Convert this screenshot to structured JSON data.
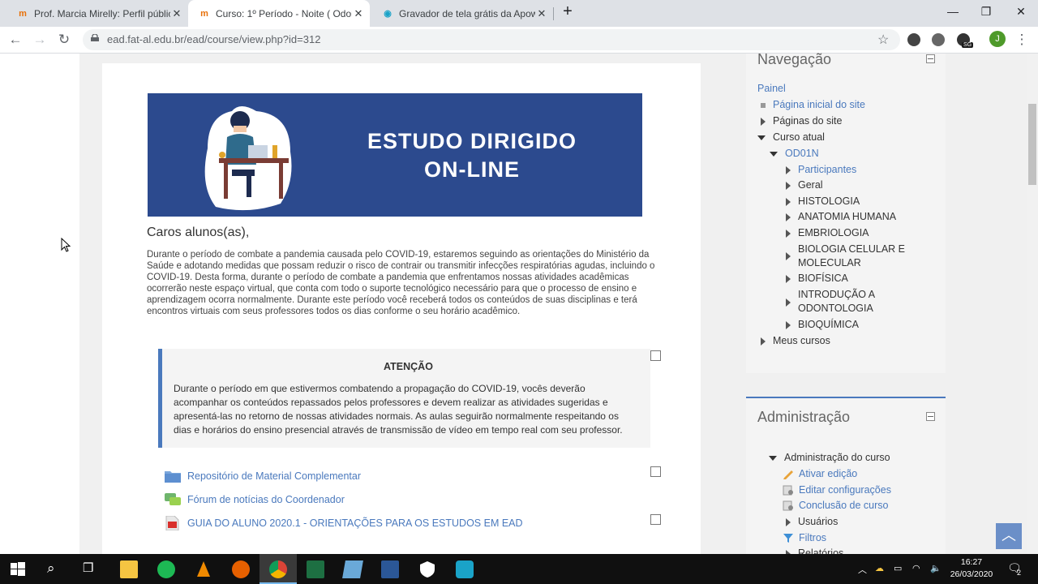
{
  "browser": {
    "tabs": [
      {
        "title": "Prof. Marcia Mirelly: Perfil público",
        "favicon": "moodle-icon",
        "active": false
      },
      {
        "title": "Curso: 1º Período - Noite ( Odon",
        "favicon": "moodle-icon",
        "active": true
      },
      {
        "title": "Gravador de tela grátis da Apowe",
        "favicon": "recorder-icon",
        "active": false
      }
    ],
    "url": "ead.fat-al.edu.br/ead/course/view.php?id=312",
    "profile_initial": "J",
    "extension_badge": "SG"
  },
  "main": {
    "banner_text_line1": "ESTUDO DIRIGIDO",
    "banner_text_line2": "ON-LINE",
    "greeting": "Caros alunos(as),",
    "intro": "Durante o período de combate a pandemia causada pelo COVID-19, estaremos seguindo as orientações do Ministério da Saúde e adotando medidas que possam reduzir o risco de contrair ou transmitir infecções respiratórias agudas, incluindo o COVID-19. Desta forma, durante o período de combate a pandemia que enfrentamos nossas atividades acadêmicas ocorrerão neste espaço virtual, que conta com todo o suporte tecnológico necessário para que o processo de ensino e aprendizagem ocorra normalmente. Durante este período você receberá todos os conteúdos de suas disciplinas e terá encontros virtuais com seus professores todos os dias conforme o seu horário acadêmico.",
    "notice_title": "ATENÇÃO",
    "notice_body": "Durante o período em que estivermos combatendo a propagação do COVID-19, vocês deverão acompanhar os conteúdos repassados pelos professores e devem realizar as atividades sugeridas e apresentá-las no retorno de nossas atividades normais. As aulas seguirão normalmente respeitando os dias e horários do ensino presencial através de transmissão de vídeo em tempo real com seu professor.",
    "resources": [
      {
        "label": "Repositório de Material Complementar",
        "icon": "folder-icon"
      },
      {
        "label": "Fórum de notícias do Coordenador",
        "icon": "forum-icon"
      },
      {
        "label": "GUIA DO ALUNO 2020.1 - ORIENTAÇÕES PARA OS ESTUDOS EM EAD",
        "icon": "pdf-icon"
      }
    ]
  },
  "navigation": {
    "title": "Navegação",
    "painel": "Painel",
    "site_home": "Página inicial do site",
    "site_pages": "Páginas do site",
    "current_course": "Curso atual",
    "course_code": "OD01N",
    "course_items": [
      "Participantes",
      "Geral",
      "HISTOLOGIA",
      "ANATOMIA HUMANA",
      "EMBRIOLOGIA",
      "BIOLOGIA CELULAR E",
      "MOLECULAR",
      "BIOFÍSICA",
      "INTRODUÇÃO A",
      "ODONTOLOGIA",
      "BIOQUÍMICA"
    ],
    "my_courses": "Meus cursos"
  },
  "administration": {
    "title": "Administração",
    "course_admin": "Administração do curso",
    "items": [
      "Ativar edição",
      "Editar configurações",
      "Conclusão de curso",
      "Usuários",
      "Filtros",
      "Relatórios"
    ]
  },
  "taskbar": {
    "time": "16:27",
    "date": "26/03/2020",
    "notifications": "2"
  }
}
